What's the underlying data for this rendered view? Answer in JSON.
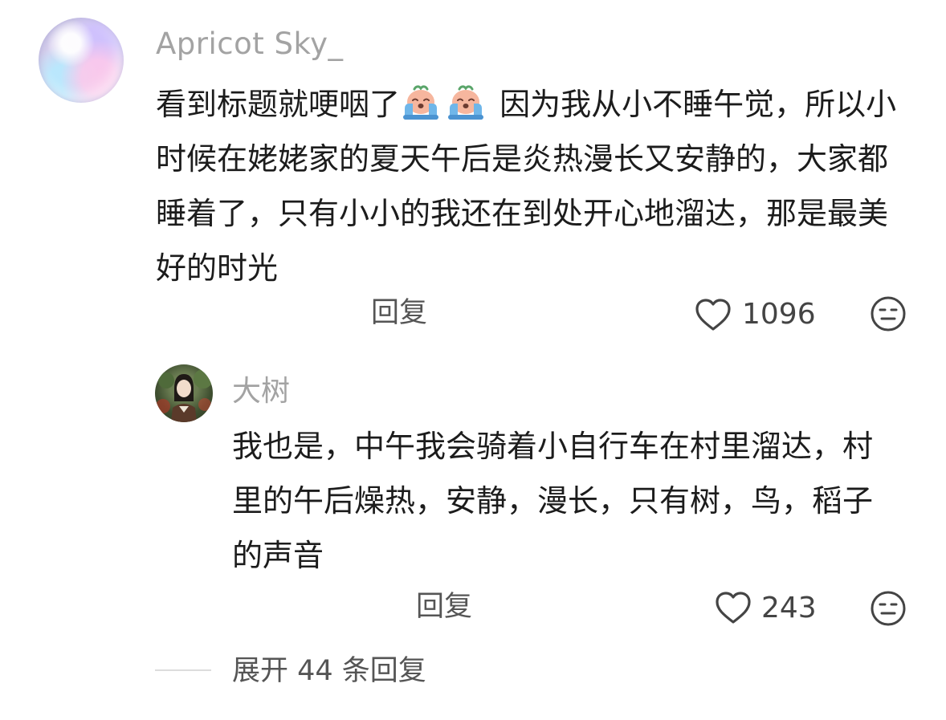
{
  "comment": {
    "username": "Apricot Sky_",
    "text_before_emoji": "看到标题就哽咽了",
    "emoji": [
      "crying-emoji",
      "crying-emoji"
    ],
    "text_after_emoji": " 因为我从小不睡午觉，所以小时候在姥姥家的夏天午后是炎热漫长又安静的，大家都睡着了，只有小小的我还在到处开心地溜达，那是最美好的时光",
    "reply_label": "回复",
    "like_count": "1096"
  },
  "reply": {
    "username": "大树",
    "text": "我也是，中午我会骑着小自行车在村里溜达，村里的午后燥热，安静，漫长，只有树，鸟，稻子的声音",
    "reply_label": "回复",
    "like_count": "243"
  },
  "expand": {
    "label": "展开 44 条回复"
  }
}
